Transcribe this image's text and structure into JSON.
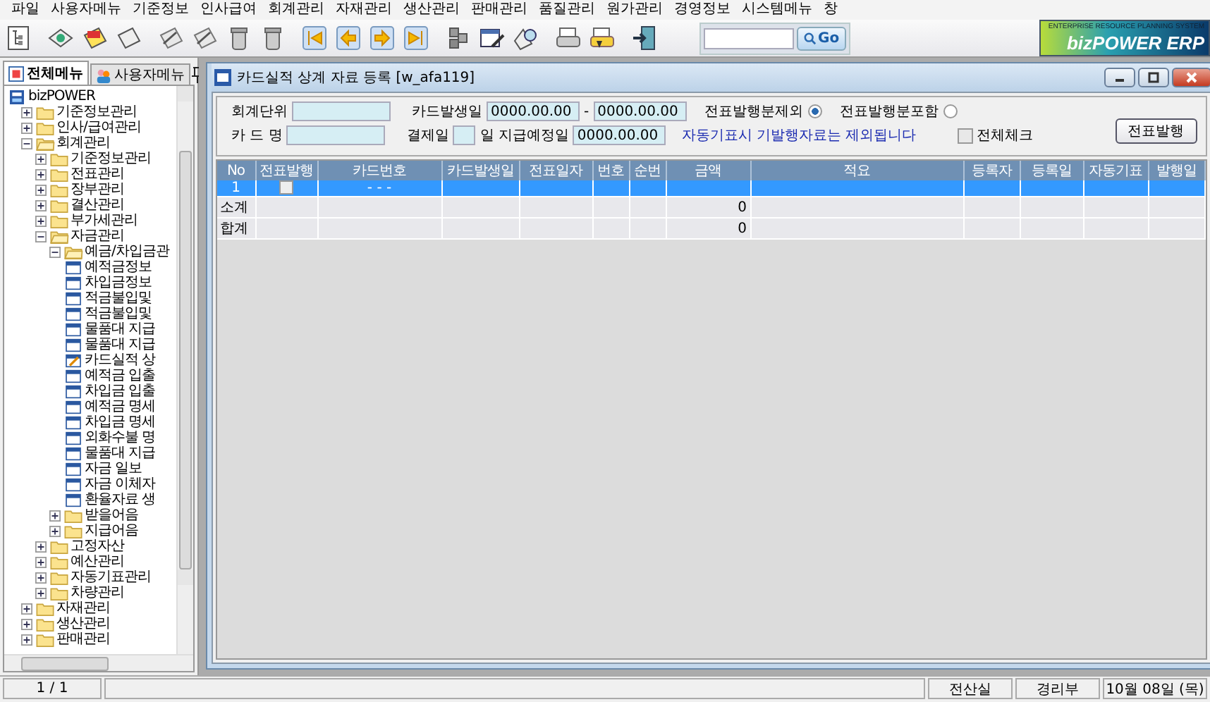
{
  "menu_bar": [
    "파일",
    "사용자메뉴",
    "기준정보",
    "인사급여",
    "회계관리",
    "자재관리",
    "생산관리",
    "판매관리",
    "품질관리",
    "원가관리",
    "경영정보",
    "시스템메뉴",
    "창"
  ],
  "toolbar": {
    "go_button": "Go",
    "logo": {
      "tagline": "ENTERPRISE RESOURCE PLANNING SYSTEM",
      "name": "bizPOWER ERP"
    }
  },
  "sidebar": {
    "tabs": [
      {
        "label": "전체메뉴",
        "selected": true
      },
      {
        "label": "사용자메뉴",
        "selected": false
      }
    ],
    "tree": [
      {
        "label": "bizPOWER",
        "kind": "root",
        "children": [
          {
            "label": "기준정보관리",
            "kind": "folder",
            "expanded": false
          },
          {
            "label": "인사/급여관리",
            "kind": "folder",
            "expanded": false
          },
          {
            "label": "회계관리",
            "kind": "folder",
            "expanded": true,
            "children": [
              {
                "label": "기준정보관리",
                "kind": "folder",
                "expanded": false
              },
              {
                "label": "전표관리",
                "kind": "folder",
                "expanded": false
              },
              {
                "label": "장부관리",
                "kind": "folder",
                "expanded": false
              },
              {
                "label": "결산관리",
                "kind": "folder",
                "expanded": false
              },
              {
                "label": "부가세관리",
                "kind": "folder",
                "expanded": false
              },
              {
                "label": "자금관리",
                "kind": "folder",
                "expanded": true,
                "children": [
                  {
                    "label": "예금/차입금관",
                    "kind": "folder",
                    "expanded": true,
                    "children": [
                      {
                        "label": "예적금정보",
                        "kind": "form"
                      },
                      {
                        "label": "차입금정보",
                        "kind": "form"
                      },
                      {
                        "label": "적금불입및",
                        "kind": "form"
                      },
                      {
                        "label": "적금불입및",
                        "kind": "form"
                      },
                      {
                        "label": "물품대 지급",
                        "kind": "form"
                      },
                      {
                        "label": "물품대 지급",
                        "kind": "form"
                      },
                      {
                        "label": "카드실적 상",
                        "kind": "open-form"
                      },
                      {
                        "label": "예적금 입출",
                        "kind": "form"
                      },
                      {
                        "label": "차입금 입출",
                        "kind": "form"
                      },
                      {
                        "label": "예적금 명세",
                        "kind": "form"
                      },
                      {
                        "label": "차입금 명세",
                        "kind": "form"
                      },
                      {
                        "label": "외화수불 명",
                        "kind": "form"
                      },
                      {
                        "label": "물품대 지급",
                        "kind": "form"
                      },
                      {
                        "label": "자금 일보",
                        "kind": "form"
                      },
                      {
                        "label": "자금 이체자",
                        "kind": "form"
                      },
                      {
                        "label": "환율자료 생",
                        "kind": "form"
                      }
                    ]
                  },
                  {
                    "label": "받을어음",
                    "kind": "folder",
                    "expanded": false
                  },
                  {
                    "label": "지급어음",
                    "kind": "folder",
                    "expanded": false
                  }
                ]
              },
              {
                "label": "고정자산",
                "kind": "folder",
                "expanded": false
              },
              {
                "label": "예산관리",
                "kind": "folder",
                "expanded": false
              },
              {
                "label": "자동기표관리",
                "kind": "folder",
                "expanded": false
              },
              {
                "label": "차량관리",
                "kind": "folder",
                "expanded": false
              }
            ]
          },
          {
            "label": "자재관리",
            "kind": "folder",
            "expanded": false
          },
          {
            "label": "생산관리",
            "kind": "folder",
            "expanded": false
          },
          {
            "label": "판매관리",
            "kind": "folder",
            "expanded": false
          }
        ]
      }
    ]
  },
  "window": {
    "title": "카드실적 상계 자료 등록 [w_afa119]",
    "form": {
      "unit_label": "회계단위",
      "card_date_label": "카드발생일",
      "card_date_from": "0000.00.00",
      "date_dash": "-",
      "card_date_to": "0000.00.00",
      "radios": [
        {
          "label": "전표발행분제외",
          "selected": true
        },
        {
          "label": "전표발행분포함",
          "selected": false
        }
      ],
      "card_name_label": "카 드 명",
      "pay_day_label": "결제일",
      "pay_day_unit": "일",
      "due_date_label": "지급예정일",
      "due_date_value": "0000.00.00",
      "notice": "자동기표시 기발행자료는 제외됩니다",
      "check_all": {
        "label": "전체체크",
        "checked": false
      },
      "issue_button": "전표발행"
    },
    "table": {
      "columns": [
        "No",
        "전표발행",
        "카드번호",
        "카드발생일",
        "전표일자",
        "번호",
        "순번",
        "금액",
        "적요",
        "등록자",
        "등록일",
        "자동기표",
        "발행일"
      ],
      "rows": [
        {
          "kind": "data",
          "selected": true,
          "no": "1",
          "issued": false,
          "card_no": "-  -  -"
        },
        {
          "kind": "total",
          "selected": false,
          "no": "소계",
          "amount": "0"
        },
        {
          "kind": "total",
          "selected": false,
          "no": "합계",
          "amount": "0"
        }
      ]
    }
  },
  "status_bar": {
    "page": "1 / 1",
    "department": "전산실",
    "team": "경리부",
    "date": "10월 08일 (목)"
  }
}
